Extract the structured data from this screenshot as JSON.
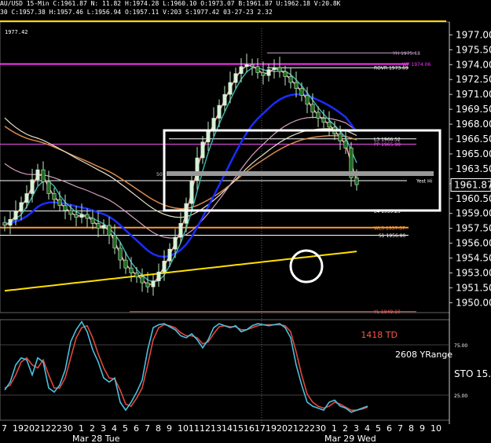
{
  "header": {
    "line1": "AU/USD 15-Min C:1961.87 N: 11.82 H:1974.28 L:1960.10 O:1973.07 B:1961.87 U:1962.18 V:20.8K",
    "line2": "30 C:1957.38 H:1957.46 L:1956.94 O:1957.11 V:203 S:1977.42 03-27-23 2.32",
    "sub_value": "1977.42"
  },
  "chart_data": [
    {
      "type": "candlestick",
      "title": "",
      "xlabel": "",
      "ylabel": "",
      "ylim": [
        1949.0,
        1978.3
      ],
      "yticks": [
        "1977.00",
        "1975.50",
        "1974.00",
        "1972.50",
        "1971.00",
        "1969.50",
        "1968.00",
        "1966.50",
        "1965.00",
        "1963.50",
        "1962.00",
        "1960.50",
        "1959.00",
        "1957.50",
        "1956.00",
        "1954.50",
        "1953.00",
        "1951.50",
        "1950.00"
      ],
      "last_price": "1961.87",
      "close_path": [
        1957.8,
        1958.4,
        1959.2,
        1960.1,
        1961.0,
        1962.4,
        1963.4,
        1962.2,
        1961.0,
        1960.4,
        1959.8,
        1959.3,
        1958.9,
        1958.6,
        1958.9,
        1958.5,
        1958.0,
        1957.5,
        1957.8,
        1956.8,
        1955.5,
        1954.3,
        1953.5,
        1953.0,
        1952.6,
        1952.0,
        1951.6,
        1952.2,
        1953.1,
        1954.2,
        1955.4,
        1956.6,
        1958.0,
        1960.0,
        1962.3,
        1964.6,
        1966.2,
        1967.4,
        1968.6,
        1969.9,
        1971.0,
        1972.2,
        1973.1,
        1973.8,
        1974.0,
        1973.8,
        1973.2,
        1972.9,
        1973.5,
        1973.7,
        1973.3,
        1972.8,
        1972.2,
        1971.6,
        1970.9,
        1970.0,
        1969.2,
        1968.6,
        1968.2,
        1967.7,
        1967.0,
        1966.3,
        1965.6,
        1962.6,
        1961.9
      ],
      "levels": [
        {
          "label": "YH 1975.18",
          "value": 1975.18,
          "color": "#c9a0c9"
        },
        {
          "label": "WP 1974.06",
          "value": 1974.06,
          "color": "#ff33ff"
        },
        {
          "label": "ROVR 1973.69",
          "value": 1973.69,
          "color": "#ffffff"
        },
        {
          "label": "L3 1966.52",
          "value": 1966.52,
          "color": "#ffffff"
        },
        {
          "label": "PP 1965.98",
          "value": 1965.98,
          "color": "#ff55ff"
        },
        {
          "label": "Yest Hi",
          "value": 1962.3,
          "color": "#ffffff"
        },
        {
          "label": "L4 1959.25",
          "value": 1959.25,
          "color": "#ffffff"
        },
        {
          "label": "WL3 1957.57",
          "value": 1957.57,
          "color": "#ff9933"
        },
        {
          "label": "S1 1956.80",
          "value": 1956.8,
          "color": "#ffffff"
        },
        {
          "label": "YL 1949.10",
          "value": 1949.1,
          "color": "#ff5555"
        }
      ],
      "box_label": "50",
      "colors": {
        "line_top": "#ffd700",
        "ma_yellow": "#ffe000",
        "ma_blue": "#1a2cff",
        "ma_cyan": "#3aaea6",
        "ma_salmon": "#f4a3a3",
        "ma_orange": "#d98a4f",
        "ma_white": "#e8e0c8",
        "ma_pink": "#d6a0c0",
        "box": "#ffffff",
        "circle": "#ffffff"
      }
    },
    {
      "type": "line",
      "title": "",
      "ylim": [
        0,
        100
      ],
      "yticks": [
        "25.00",
        "75.00"
      ],
      "sto_label": "STO",
      "sto_value": "15.",
      "td_label": "1418 TD",
      "yrange_label": "2608 YRange",
      "series": [
        {
          "values": [
            30,
            38,
            55,
            62,
            60,
            45,
            62,
            58,
            32,
            28,
            35,
            50,
            78,
            90,
            98,
            88,
            70,
            58,
            42,
            38,
            42,
            18,
            10,
            18,
            28,
            40,
            70,
            92,
            95,
            96,
            93,
            90,
            84,
            82,
            86,
            80,
            72,
            80,
            92,
            96,
            94,
            92,
            94,
            88,
            90,
            94,
            96,
            95,
            94,
            95,
            96,
            92,
            82,
            55,
            35,
            18,
            14,
            12,
            10,
            18,
            20,
            14,
            12,
            8,
            10,
            12,
            14
          ]
        },
        {
          "values": [
            32,
            35,
            45,
            58,
            62,
            55,
            52,
            60,
            45,
            32,
            32,
            42,
            62,
            82,
            92,
            94,
            82,
            66,
            52,
            42,
            41,
            30,
            16,
            14,
            22,
            32,
            55,
            80,
            92,
            95,
            94,
            92,
            87,
            84,
            84,
            82,
            76,
            78,
            86,
            93,
            94,
            93,
            93,
            90,
            90,
            92,
            94,
            95,
            95,
            95,
            95,
            94,
            88,
            68,
            45,
            26,
            18,
            14,
            12,
            14,
            18,
            16,
            13,
            10,
            10,
            11,
            13
          ]
        }
      ],
      "colors": {
        "fast": "#4ac1e0",
        "slow": "#e2473d",
        "td": "#ff5544"
      }
    }
  ],
  "xaxis": {
    "ticks": [
      "7",
      "19",
      "20",
      "21",
      "22",
      "23",
      "0",
      "1",
      "2",
      "3",
      "4",
      "5",
      "6",
      "7",
      "8",
      "9",
      "10",
      "11",
      "12",
      "13",
      "14",
      "15",
      "16",
      "17",
      "19",
      "20",
      "21",
      "22",
      "23",
      "0",
      "1",
      "2",
      "3",
      "4",
      "5",
      "6",
      "7",
      "8",
      "9",
      "10"
    ],
    "date1": "Mar 28 Tue",
    "date2": "Mar 29 Wed"
  }
}
